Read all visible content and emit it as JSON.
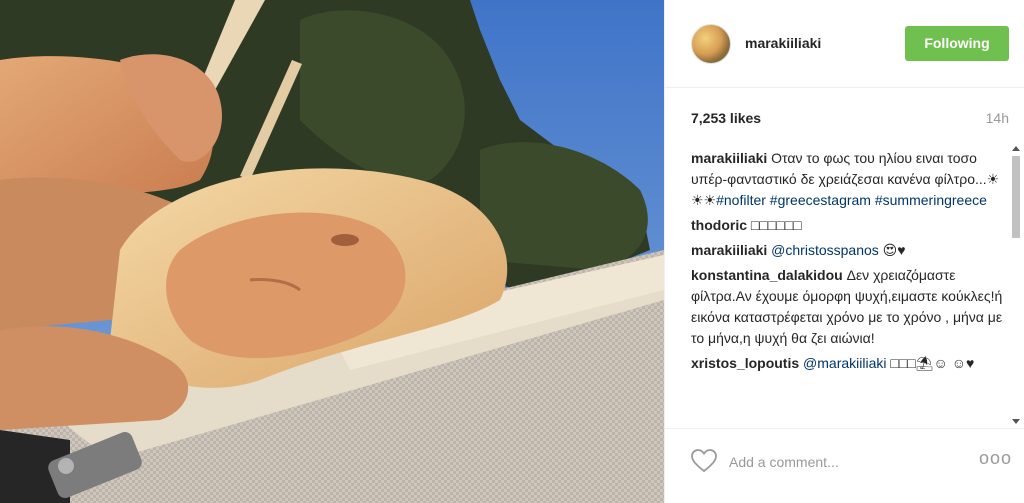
{
  "post": {
    "author": "marakiiliaki",
    "follow_button": "Following",
    "likes": "7,253 likes",
    "time_ago": "14h",
    "photo_icon": "photo-image"
  },
  "comments": [
    {
      "user": "marakiiliaki",
      "text": "Οταν το φως του ηλίου ειναι τοσο υπέρ-φανταστικό δε χρειάζεσαι κανένα φίλτρο...☀☀☀",
      "hashtags": "#nofilter #greecestagram #summeringreece"
    },
    {
      "user": "thodoric",
      "text": "□□□□□□"
    },
    {
      "user": "marakiiliaki",
      "mention": "@christosspanos",
      "text": "😍♥"
    },
    {
      "user": "konstantina_dalakidou",
      "text": "Δεν χρειαζόμαστε φίλτρα.Αν έχουμε όμορφη ψυχή,ειμαστε κούκλες!ή εικόνα καταστρέφεται χρόνο με το χρόνο , μήνα με το μήνα,η ψυχή θα ζει αιώνια!"
    },
    {
      "user": "xristos_lopoutis",
      "mention": "@marakiiliaki",
      "text": "□□□⛱☺ ☺♥"
    }
  ],
  "footer": {
    "comment_placeholder": "Add a comment...",
    "more_label": "ooo"
  },
  "colors": {
    "follow_green": "#70c050",
    "link_blue": "#003569",
    "muted_gray": "#999999"
  }
}
